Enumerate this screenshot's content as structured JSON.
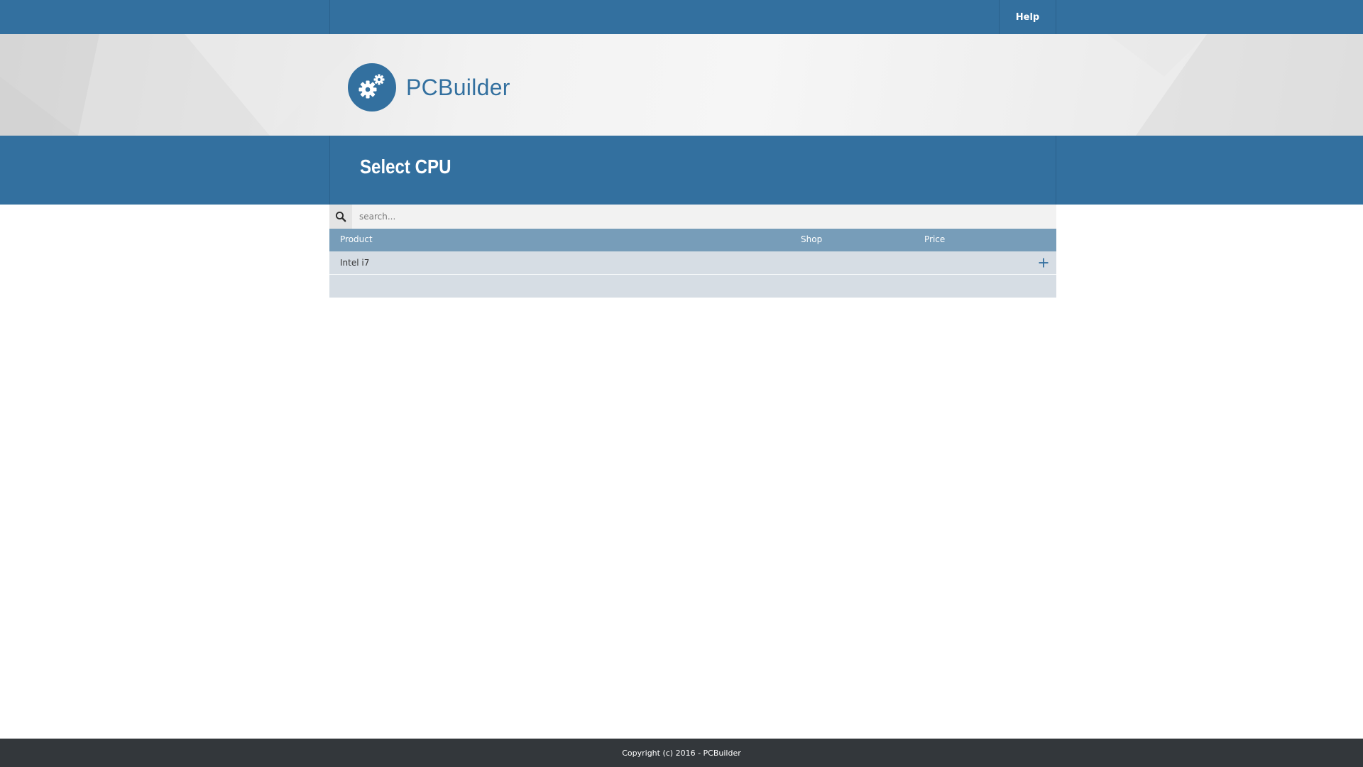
{
  "nav": {
    "help_label": "Help"
  },
  "brand": {
    "name": "PCBuilder",
    "icon": "gears-icon",
    "color": "#33709f"
  },
  "page": {
    "title": "Select CPU"
  },
  "search": {
    "placeholder": "search...",
    "value": ""
  },
  "table": {
    "columns": {
      "product": "Product",
      "shop": "Shop",
      "price": "Price"
    },
    "rows": [
      {
        "product": "Intel i7",
        "shop": "",
        "price": "",
        "action_icon": "plus-icon"
      }
    ]
  },
  "footer": {
    "copyright": "Copyright (c) 2016 - PCBuilder"
  }
}
